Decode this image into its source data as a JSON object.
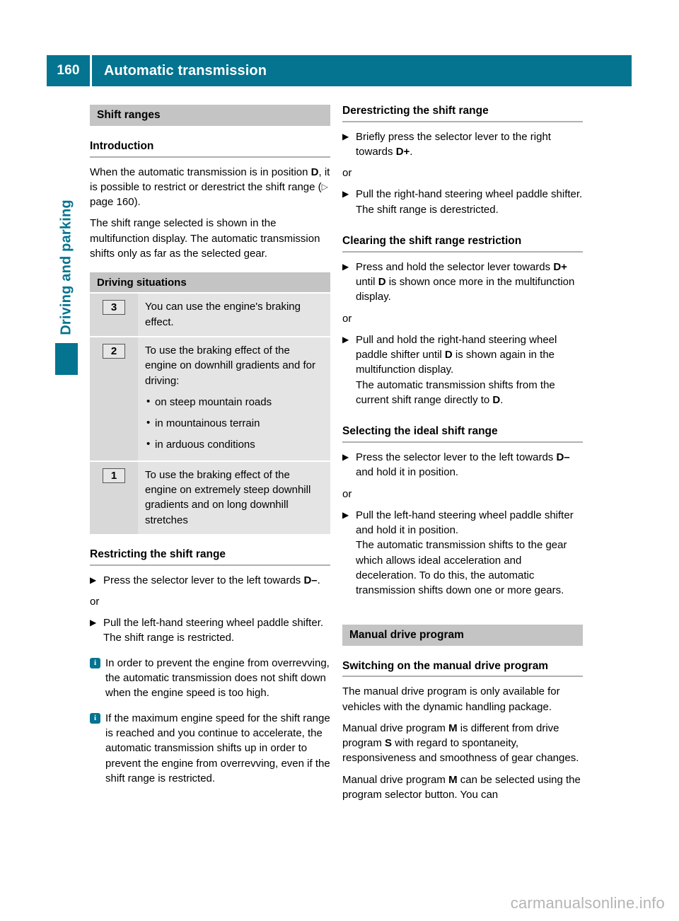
{
  "header": {
    "page_number": "160",
    "title": "Automatic transmission",
    "accent_color": "#047490"
  },
  "side_tab": {
    "label": "Driving and parking",
    "color": "#047490"
  },
  "left_column": {
    "section_title": "Shift ranges",
    "introduction": {
      "heading": "Introduction",
      "paragraph_1_a": "When the automatic transmission is in position ",
      "paragraph_1_b": "D",
      "paragraph_1_c": ", it is possible to restrict or derestrict the shift range (",
      "paragraph_1_arrow": "▷",
      "paragraph_1_d": " page 160).",
      "paragraph_2": "The shift range selected is shown in the multifunction display. The automatic transmission shifts only as far as the selected gear."
    },
    "driving_situations": {
      "table_header": "Driving situations",
      "rows": [
        {
          "gear": "3",
          "text": "You can use the engine's braking effect.",
          "bullets": []
        },
        {
          "gear": "2",
          "text": "To use the braking effect of the engine on downhill gradients and for driving:",
          "bullets": [
            "on steep mountain roads",
            "in mountainous terrain",
            "in arduous conditions"
          ]
        },
        {
          "gear": "1",
          "text": "To use the braking effect of the engine on extremely steep downhill gradients and on long downhill stretches",
          "bullets": []
        }
      ]
    },
    "restricting": {
      "heading": "Restricting the shift range",
      "step_1_a": "Press the selector lever to the left towards ",
      "step_1_b": "D–",
      "step_1_c": ".",
      "or": "or",
      "step_2": "Pull the left-hand steering wheel paddle shifter.",
      "step_2_result": "The shift range is restricted."
    },
    "notes": [
      "In order to prevent the engine from overrevving, the automatic transmission does not shift down when the engine speed is too high.",
      "If the maximum engine speed for the shift range is reached and you continue to accelerate, the automatic transmission shifts up in order to prevent the engine from overrevving, even if the shift range is restricted."
    ]
  },
  "right_column": {
    "derestricting": {
      "heading": "Derestricting the shift range",
      "step_1_a": "Briefly press the selector lever to the right towards ",
      "step_1_b": "D+",
      "step_1_c": ".",
      "or": "or",
      "step_2": "Pull the right-hand steering wheel paddle shifter.",
      "step_2_result": "The shift range is derestricted."
    },
    "clearing": {
      "heading": "Clearing the shift range restriction",
      "step_1_a": "Press and hold the selector lever towards ",
      "step_1_b": "D+",
      "step_1_c": " until ",
      "step_1_d": "D",
      "step_1_e": " is shown once more in the multifunction display.",
      "or": "or",
      "step_2_a": "Pull and hold the right-hand steering wheel paddle shifter until ",
      "step_2_b": "D",
      "step_2_c": " is shown again in the multifunction display.",
      "step_2_result_a": "The automatic transmission shifts from the current shift range directly to ",
      "step_2_result_b": "D",
      "step_2_result_c": "."
    },
    "selecting": {
      "heading": "Selecting the ideal shift range",
      "step_1_a": "Press the selector lever to the left towards ",
      "step_1_b": "D–",
      "step_1_c": " and hold it in position.",
      "or": "or",
      "step_2": "Pull the left-hand steering wheel paddle shifter and hold it in position.",
      "step_2_result": "The automatic transmission shifts to the gear which allows ideal acceleration and deceleration. To do this, the automatic transmission shifts down one or more gears."
    },
    "manual_program": {
      "section_title": "Manual drive program",
      "heading": "Switching on the manual drive program",
      "paragraph_1": "The manual drive program is only available for vehicles with the dynamic handling package.",
      "paragraph_2_a": "Manual drive program ",
      "paragraph_2_b": "M",
      "paragraph_2_c": " is different from drive program ",
      "paragraph_2_d": "S",
      "paragraph_2_e": " with regard to spontaneity, responsiveness and smoothness of gear changes.",
      "paragraph_3_a": "Manual drive program ",
      "paragraph_3_b": "M",
      "paragraph_3_c": " can be selected using the program selector button. You can"
    }
  },
  "bullet_marker": "▶",
  "list_dot": "•",
  "info_icon_letter": "i",
  "watermark": "carmanualsonline.info"
}
